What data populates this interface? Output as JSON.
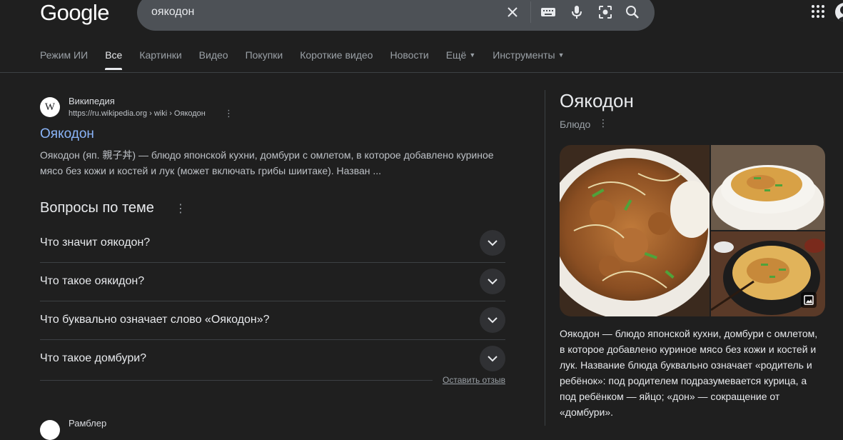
{
  "logo": "Google",
  "search": {
    "query": "оякодон"
  },
  "tabs": [
    {
      "label": "Режим ИИ"
    },
    {
      "label": "Все"
    },
    {
      "label": "Картинки"
    },
    {
      "label": "Видео"
    },
    {
      "label": "Покупки"
    },
    {
      "label": "Короткие видео"
    },
    {
      "label": "Новости"
    },
    {
      "label": "Ещё"
    },
    {
      "label": "Инструменты"
    }
  ],
  "result": {
    "favicon": "W",
    "site_name": "Википедия",
    "url": "https://ru.wikipedia.org › wiki › Оякодон",
    "title": "Оякодон",
    "snippet": "Оякодон (яп. 親子丼) — блюдо японской кухни, домбури с омлетом, в которое добавлено куриное мясо без кожи и костей и лук (может включать грибы шиитаке). Назван ..."
  },
  "paa": {
    "heading": "Вопросы по теме",
    "questions": [
      "Что значит оякодон?",
      "Что такое оякидон?",
      "Что буквально означает слово «Оякодон»?",
      "Что такое домбури?"
    ],
    "feedback": "Оставить отзыв"
  },
  "next_result": {
    "site_name": "Рамблер"
  },
  "knowledge_panel": {
    "title": "Оякодон",
    "subtitle": "Блюдо",
    "description": "Оякодон — блюдо японской кухни, домбури с омлетом, в которое добавлено куриное мясо без кожи и костей и лук. Название блюда буквально означает «родитель и ребёнок»: под родителем подразумевается курица, а под ребёнком — яйцо; «дон» — сокращение от «домбури»."
  },
  "icons": [
    "clear-icon",
    "keyboard-icon",
    "mic-icon",
    "lens-icon",
    "search-icon",
    "apps-icon",
    "more-vert-icon",
    "chevron-down-icon",
    "image-icon"
  ],
  "colors": {
    "background": "#1f1f1f",
    "link": "#8ab4f8",
    "searchbar": "#4d5156"
  }
}
